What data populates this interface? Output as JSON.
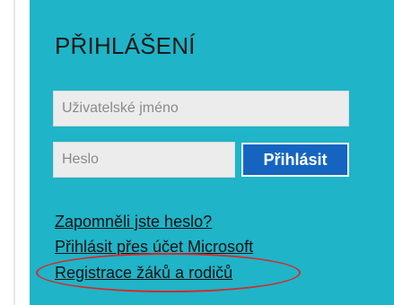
{
  "login": {
    "title": "PŘIHLÁŠENÍ",
    "username_placeholder": "Uživatelské jméno",
    "password_placeholder": "Heslo",
    "login_button": "Přihlásit",
    "links": {
      "forgot_password": "Zapomněli jste heslo?",
      "microsoft_login": "Přihlásit přes účet Microsoft",
      "registration": "Registrace žáků a rodičů"
    }
  },
  "colors": {
    "panel_background": "#1fb4c8",
    "button_background": "#1565c0",
    "highlight_oval": "#d42b2b"
  }
}
